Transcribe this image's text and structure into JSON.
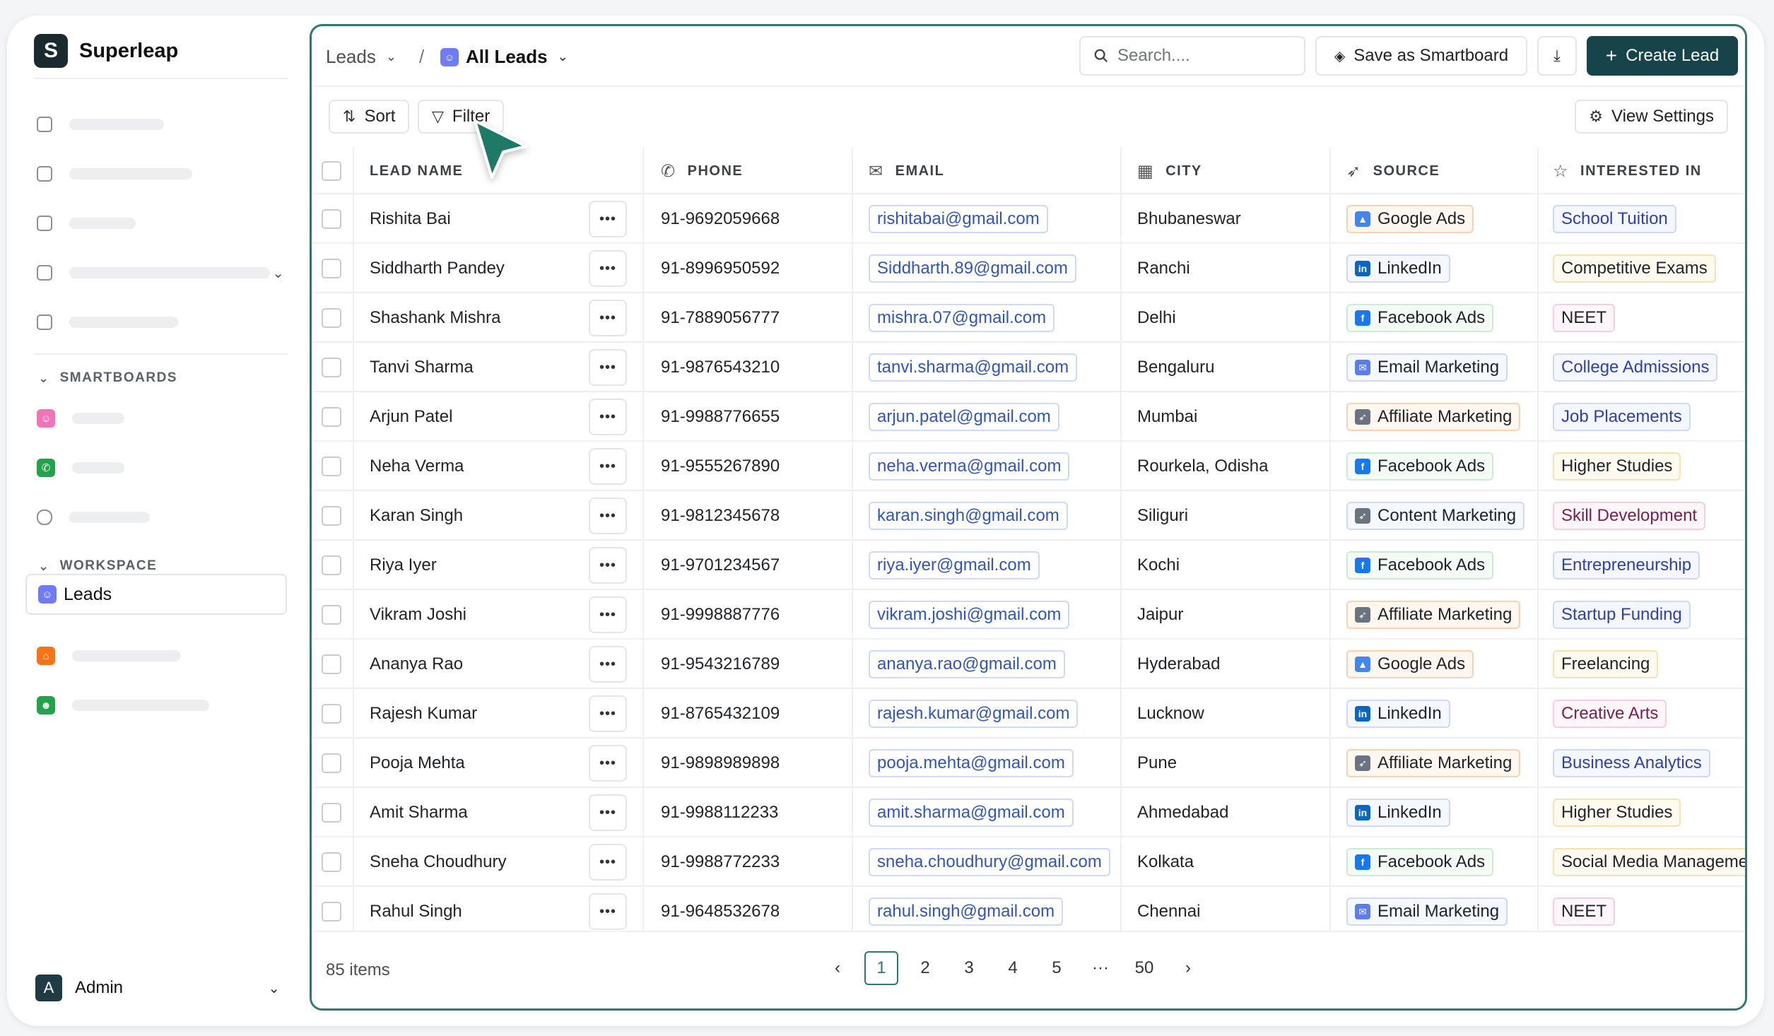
{
  "brand": {
    "name": "Superleap",
    "logo_letter": "S"
  },
  "sidebar": {
    "smartboards_label": "SMARTBOARDS",
    "workspace_label": "WORKSPACE",
    "active_item": "Leads",
    "user": {
      "initial": "A",
      "name": "Admin"
    }
  },
  "header": {
    "crumb_root": "Leads",
    "crumb_sep": "/",
    "crumb_current": "All Leads",
    "search_placeholder": "Search....",
    "save_smartboard": "Save as Smartboard",
    "create_lead": "Create Lead"
  },
  "toolbar": {
    "sort": "Sort",
    "filter": "Filter",
    "view_settings": "View Settings"
  },
  "columns": {
    "name": "LEAD NAME",
    "phone": "PHONE",
    "email": "EMAIL",
    "city": "CITY",
    "source": "SOURCE",
    "interest": "INTERESTED IN"
  },
  "rows": [
    {
      "name": "Rishita Bai",
      "phone": "91-9692059668",
      "email": "rishitabai@gmail.com",
      "city": "Bhubaneswar",
      "source": "Google Ads",
      "interest": "School Tuition"
    },
    {
      "name": "Siddharth Pandey",
      "phone": "91-8996950592",
      "email": "Siddharth.89@gmail.com",
      "city": "Ranchi",
      "source": "LinkedIn",
      "interest": "Competitive Exams"
    },
    {
      "name": "Shashank Mishra",
      "phone": "91-7889056777",
      "email": "mishra.07@gmail.com",
      "city": "Delhi",
      "source": "Facebook Ads",
      "interest": "NEET"
    },
    {
      "name": "Tanvi Sharma",
      "phone": "91-9876543210",
      "email": "tanvi.sharma@gmail.com",
      "city": "Bengaluru",
      "source": "Email Marketing",
      "interest": "College Admissions"
    },
    {
      "name": "Arjun Patel",
      "phone": "91-9988776655",
      "email": "arjun.patel@gmail.com",
      "city": "Mumbai",
      "source": "Affiliate Marketing",
      "interest": "Job Placements"
    },
    {
      "name": "Neha Verma",
      "phone": "91-9555267890",
      "email": "neha.verma@gmail.com",
      "city": "Rourkela, Odisha",
      "source": "Facebook Ads",
      "interest": "Higher Studies"
    },
    {
      "name": "Karan Singh",
      "phone": "91-9812345678",
      "email": "karan.singh@gmail.com",
      "city": "Siliguri",
      "source": "Content Marketing",
      "interest": "Skill Development"
    },
    {
      "name": "Riya Iyer",
      "phone": "91-9701234567",
      "email": "riya.iyer@gmail.com",
      "city": "Kochi",
      "source": "Facebook Ads",
      "interest": "Entrepreneurship"
    },
    {
      "name": "Vikram Joshi",
      "phone": "91-9998887776",
      "email": "vikram.joshi@gmail.com",
      "city": "Jaipur",
      "source": "Affiliate Marketing",
      "interest": "Startup Funding"
    },
    {
      "name": "Ananya Rao",
      "phone": "91-9543216789",
      "email": "ananya.rao@gmail.com",
      "city": "Hyderabad",
      "source": "Google Ads",
      "interest": "Freelancing"
    },
    {
      "name": "Rajesh Kumar",
      "phone": "91-8765432109",
      "email": "rajesh.kumar@gmail.com",
      "city": "Lucknow",
      "source": "LinkedIn",
      "interest": "Creative Arts"
    },
    {
      "name": "Pooja Mehta",
      "phone": "91-9898989898",
      "email": "pooja.mehta@gmail.com",
      "city": "Pune",
      "source": "Affiliate Marketing",
      "interest": "Business Analytics"
    },
    {
      "name": "Amit Sharma",
      "phone": "91-9988112233",
      "email": "amit.sharma@gmail.com",
      "city": "Ahmedabad",
      "source": "LinkedIn",
      "interest": "Higher Studies"
    },
    {
      "name": "Sneha Choudhury",
      "phone": "91-9988772233",
      "email": "sneha.choudhury@gmail.com",
      "city": "Kolkata",
      "source": "Facebook Ads",
      "interest": "Social Media Management"
    },
    {
      "name": "Rahul Singh",
      "phone": "91-9648532678",
      "email": "rahul.singh@gmail.com",
      "city": "Chennai",
      "source": "Email Marketing",
      "interest": "NEET"
    }
  ],
  "footer": {
    "items_count": "85 items",
    "pages": [
      "1",
      "2",
      "3",
      "4",
      "5",
      "···",
      "50"
    ],
    "current_page": "1"
  },
  "colors": {
    "accent": "#17434b",
    "border_active": "#2e7a70",
    "email_text": "#2f55c4"
  }
}
